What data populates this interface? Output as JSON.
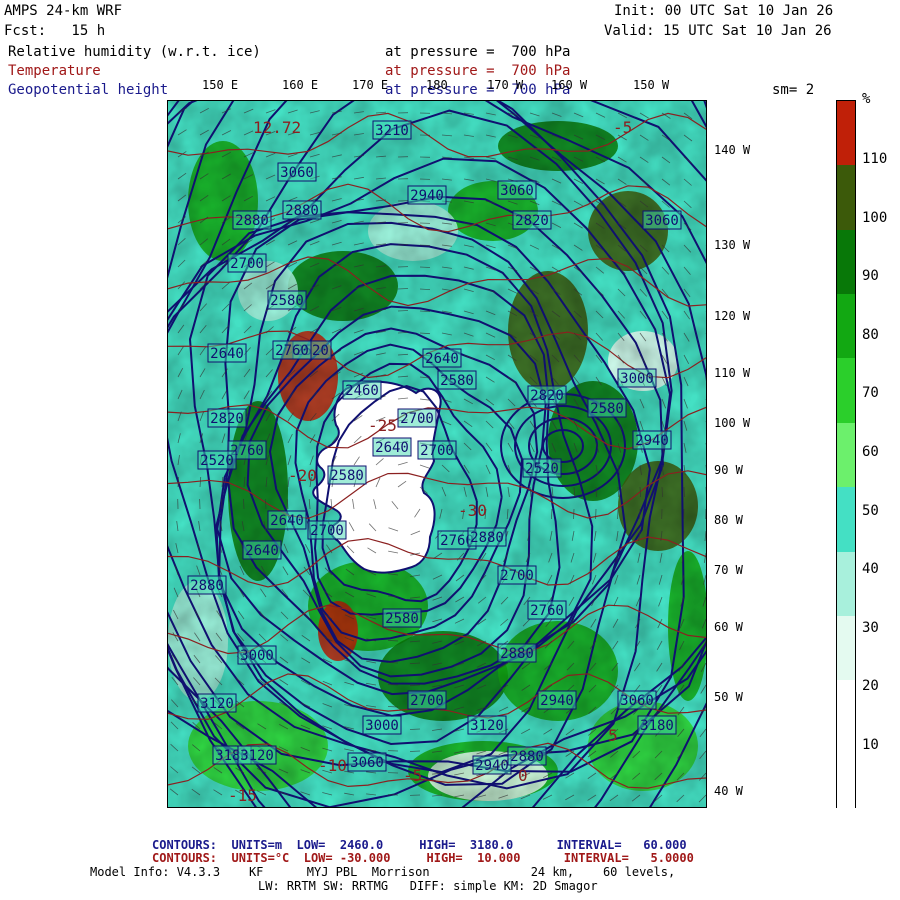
{
  "header": {
    "model": "AMPS 24-km WRF",
    "fcst": "Fcst:   15 h",
    "init": "Init: 00 UTC Sat 10 Jan 26",
    "valid": "Valid: 15 UTC Sat 10 Jan 26",
    "field1_name": "Relative humidity (w.r.t. ice)",
    "field1_level": "at pressure =  700 hPa",
    "field2_name": "Temperature",
    "field2_level": "at pressure =  700 hPa",
    "field3_name": "Geopotential height",
    "field3_level": "at pressure =  700 hPa",
    "smoothing": "sm= 2"
  },
  "colors": {
    "rh_bins": [
      "#ffffff",
      "#ffffff",
      "#e4faf0",
      "#a8f0dc",
      "#44e0c4",
      "#6cf06c",
      "#2bcf2b",
      "#12a812",
      "#087808",
      "#3c5a0a",
      "#c02008"
    ],
    "height_contour": "#101070",
    "temp_contour": "#8b2020",
    "land": "#ffffff"
  },
  "lon_labels_top": [
    "150 E",
    "160 E",
    "170 E",
    "180",
    "170 W",
    "160 W",
    "150 W"
  ],
  "lat_labels_right": [
    "140 W",
    "130 W",
    "120 W",
    "110 W",
    "100 W",
    "90 W",
    "80 W",
    "70 W",
    "60 W",
    "50 W",
    "40 W"
  ],
  "colorbar": {
    "unit": "%",
    "ticks": [
      "110",
      "100",
      "90",
      "80",
      "70",
      "60",
      "50",
      "40",
      "30",
      "20",
      "10"
    ]
  },
  "map_labels": {
    "heights": [
      "3210",
      "3060",
      "2880",
      "2940",
      "3060",
      "2820",
      "2880",
      "2700",
      "2640",
      "2580",
      "2520",
      "2460",
      "2640",
      "2760",
      "2820",
      "2580",
      "2700",
      "2820",
      "2580",
      "2640",
      "2760",
      "2760",
      "2520",
      "2520",
      "2640",
      "2700",
      "2880",
      "2940",
      "3120",
      "3000",
      "3180",
      "3120",
      "3060",
      "2940",
      "2880",
      "3060",
      "3000",
      "3120",
      "3180",
      "2880",
      "2700",
      "2580",
      "2580",
      "2700",
      "2640",
      "2700",
      "2880",
      "2940",
      "2760",
      "3000",
      "3060"
    ],
    "temps": [
      "12.72",
      "-5",
      "-20",
      "-25",
      "-30",
      "-15",
      "-10",
      "-5",
      "0",
      "5"
    ]
  },
  "footer": {
    "contour1": "CONTOURS:  UNITS=m  LOW=  2460.0     HIGH=  3180.0      INTERVAL=   60.000",
    "contour2": "CONTOURS:  UNITS=°C  LOW= -30.000     HIGH=  10.000      INTERVAL=   5.0000",
    "model_info": "Model Info: V4.3.3    KF      MYJ PBL  Morrison              24 km,    60 levels,",
    "physics": "LW: RRTM SW: RRTMG   DIFF: simple KM: 2D Smagor"
  }
}
